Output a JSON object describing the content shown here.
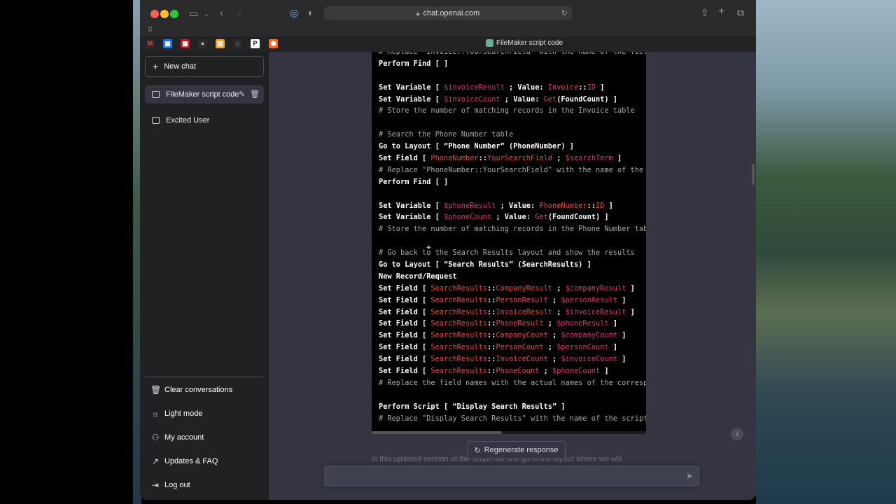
{
  "browser": {
    "url": "chat.openai.com",
    "tab_title": "FileMaker script code"
  },
  "sidebar": {
    "new_chat": "New chat",
    "conversations": [
      {
        "title": "FileMaker script code",
        "active": true
      },
      {
        "title": "Excited User",
        "active": false
      }
    ],
    "bottom_items": [
      {
        "label": "Clear conversations",
        "icon": "trash-icon"
      },
      {
        "label": "Light mode",
        "icon": "sun-icon"
      },
      {
        "label": "My account",
        "icon": "user-icon"
      },
      {
        "label": "Updates & FAQ",
        "icon": "external-link-icon"
      },
      {
        "label": "Log out",
        "icon": "logout-icon"
      }
    ]
  },
  "code": {
    "lines": [
      [
        {
          "t": "# Replace \"Invoice::YourSearchField\" with the name of the field",
          "c": "cmt"
        }
      ],
      [
        {
          "t": "Perform Find [ ]"
        }
      ],
      [],
      [
        {
          "t": "Set Variable [ "
        },
        {
          "t": "$invoiceResult",
          "c": "var"
        },
        {
          "t": " ; Value: "
        },
        {
          "t": "Invoice",
          "c": "fld"
        },
        {
          "t": "::"
        },
        {
          "t": "ID",
          "c": "fld"
        },
        {
          "t": " ]"
        }
      ],
      [
        {
          "t": "Set Variable [ "
        },
        {
          "t": "$invoiceCount",
          "c": "var"
        },
        {
          "t": " ; Value: "
        },
        {
          "t": "Get",
          "c": "fld"
        },
        {
          "t": "(FoundCount) ]"
        }
      ],
      [
        {
          "t": "# Store the number of matching records in the Invoice table",
          "c": "cmt"
        }
      ],
      [],
      [
        {
          "t": "# Search the Phone Number table",
          "c": "cmt"
        }
      ],
      [
        {
          "t": "Go to Layout [ “Phone Number” (PhoneNumber) ]"
        }
      ],
      [
        {
          "t": "Set Field [ "
        },
        {
          "t": "PhoneNumber",
          "c": "fld"
        },
        {
          "t": "::"
        },
        {
          "t": "YourSearchField",
          "c": "fld"
        },
        {
          "t": " ; "
        },
        {
          "t": "$searchTerm",
          "c": "var"
        },
        {
          "t": " ]"
        }
      ],
      [
        {
          "t": "# Replace \"PhoneNumber::YourSearchField\" with the name of the fie",
          "c": "cmt"
        }
      ],
      [
        {
          "t": "Perform Find [ ]"
        }
      ],
      [],
      [
        {
          "t": "Set Variable [ "
        },
        {
          "t": "$phoneResult",
          "c": "var"
        },
        {
          "t": " ; Value: "
        },
        {
          "t": "PhoneNumber",
          "c": "fld"
        },
        {
          "t": "::"
        },
        {
          "t": "ID",
          "c": "fld"
        },
        {
          "t": " ]"
        }
      ],
      [
        {
          "t": "Set Variable [ "
        },
        {
          "t": "$phoneCount",
          "c": "var"
        },
        {
          "t": " ; Value: "
        },
        {
          "t": "Get",
          "c": "fld"
        },
        {
          "t": "(FoundCount) ]"
        }
      ],
      [
        {
          "t": "# Store the number of matching records in the Phone Number table",
          "c": "cmt"
        }
      ],
      [],
      [
        {
          "t": "# Go back to the Search Results layout and show the results",
          "c": "cmt"
        }
      ],
      [
        {
          "t": "Go to Layout [ “Search Results” (SearchResults) ]"
        }
      ],
      [
        {
          "t": "New Record/Request"
        }
      ],
      [
        {
          "t": "Set Field [ "
        },
        {
          "t": "SearchResults",
          "c": "fld"
        },
        {
          "t": "::"
        },
        {
          "t": "CompanyResult",
          "c": "fld"
        },
        {
          "t": " ; "
        },
        {
          "t": "$companyResult",
          "c": "var"
        },
        {
          "t": " ]"
        }
      ],
      [
        {
          "t": "Set Field [ "
        },
        {
          "t": "SearchResults",
          "c": "fld"
        },
        {
          "t": "::"
        },
        {
          "t": "PersonResult",
          "c": "fld"
        },
        {
          "t": " ; "
        },
        {
          "t": "$personResult",
          "c": "var"
        },
        {
          "t": " ]"
        }
      ],
      [
        {
          "t": "Set Field [ "
        },
        {
          "t": "SearchResults",
          "c": "fld"
        },
        {
          "t": "::"
        },
        {
          "t": "InvoiceResult",
          "c": "fld"
        },
        {
          "t": " ; "
        },
        {
          "t": "$invoiceResult",
          "c": "var"
        },
        {
          "t": " ]"
        }
      ],
      [
        {
          "t": "Set Field [ "
        },
        {
          "t": "SearchResults",
          "c": "fld"
        },
        {
          "t": "::"
        },
        {
          "t": "PhoneResult",
          "c": "fld"
        },
        {
          "t": " ; "
        },
        {
          "t": "$phoneResult",
          "c": "var"
        },
        {
          "t": " ]"
        }
      ],
      [
        {
          "t": "Set Field [ "
        },
        {
          "t": "SearchResults",
          "c": "fld"
        },
        {
          "t": "::"
        },
        {
          "t": "CompanyCount",
          "c": "fld"
        },
        {
          "t": " ; "
        },
        {
          "t": "$companyCount",
          "c": "var"
        },
        {
          "t": " ]"
        }
      ],
      [
        {
          "t": "Set Field [ "
        },
        {
          "t": "SearchResults",
          "c": "fld"
        },
        {
          "t": "::"
        },
        {
          "t": "PersonCount",
          "c": "fld"
        },
        {
          "t": " ; "
        },
        {
          "t": "$personCount",
          "c": "var"
        },
        {
          "t": " ]"
        }
      ],
      [
        {
          "t": "Set Field [ "
        },
        {
          "t": "SearchResults",
          "c": "fld"
        },
        {
          "t": "::"
        },
        {
          "t": "InvoiceCount",
          "c": "fld"
        },
        {
          "t": " ; "
        },
        {
          "t": "$invoiceCount",
          "c": "var"
        },
        {
          "t": " ]"
        }
      ],
      [
        {
          "t": "Set Field [ "
        },
        {
          "t": "SearchResults",
          "c": "fld"
        },
        {
          "t": "::"
        },
        {
          "t": "PhoneCount",
          "c": "fld"
        },
        {
          "t": " ; "
        },
        {
          "t": "$phoneCount",
          "c": "var"
        },
        {
          "t": " ]"
        }
      ],
      [
        {
          "t": "# Replace the field names with the actual names of the correspon",
          "c": "cmt"
        }
      ],
      [],
      [
        {
          "t": "Perform Script [ “Display Search Results” ]"
        }
      ],
      [
        {
          "t": "# Replace \"Display Search Results\" with the name of the script th",
          "c": "cmt"
        }
      ]
    ]
  },
  "main": {
    "regenerate_label": "Regenerate response",
    "faded_text": "In this updated version of the script, we first go to the layout where we will",
    "input_placeholder": ""
  },
  "colors": {
    "sidebar_bg": "#202123",
    "main_bg": "#343541",
    "code_bg": "#000000",
    "comment": "#a8a8a8",
    "variable": "#df3079",
    "field": "#ef4146"
  }
}
